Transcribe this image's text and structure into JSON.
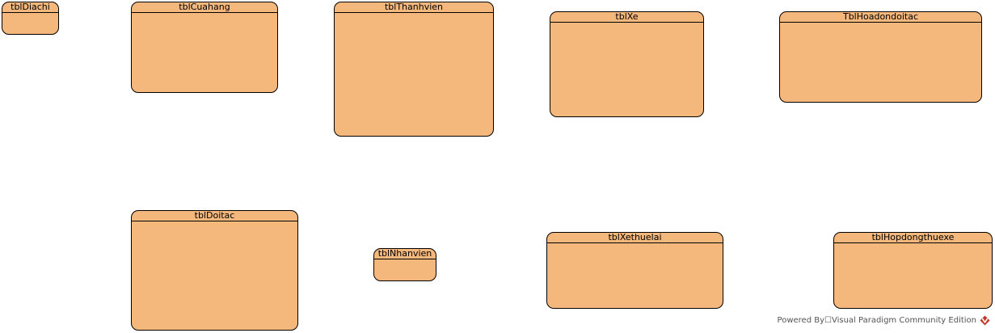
{
  "diagram": {
    "entity_fill": "#f4b77c",
    "border_color": "#000000",
    "entities": [
      {
        "id": "tblDiachi",
        "name": "tblDiachi"
      },
      {
        "id": "tblCuahang",
        "name": "tblCuahang"
      },
      {
        "id": "tblThanhvien",
        "name": "tblThanhvien"
      },
      {
        "id": "tblXe",
        "name": "tblXe"
      },
      {
        "id": "TblHoadondoitac",
        "name": "TblHoadondoitac"
      },
      {
        "id": "tblDoitac",
        "name": "tblDoitac"
      },
      {
        "id": "tblNhanvien",
        "name": "tblNhanvien"
      },
      {
        "id": "tblXethuelai",
        "name": "tblXethuelai"
      },
      {
        "id": "tblHopdongthuexe",
        "name": "tblHopdongthuexe"
      }
    ]
  },
  "watermark": {
    "text": "Powered By☐Visual Paradigm Community Edition",
    "icon": "visual-paradigm-logo-icon",
    "icon_color": "#c0392b"
  }
}
